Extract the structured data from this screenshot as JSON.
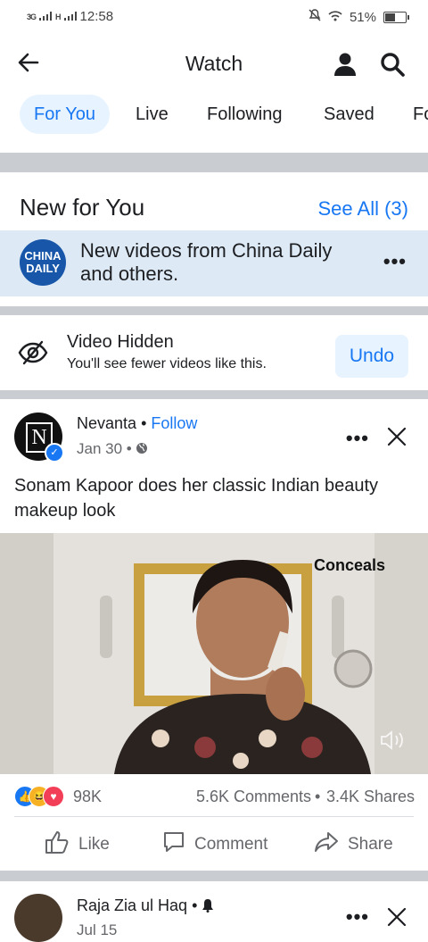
{
  "status_bar": {
    "network1": "3G",
    "network2": "H",
    "time": "12:58",
    "battery": "51%",
    "battery_fraction": 0.51
  },
  "header": {
    "title": "Watch"
  },
  "tabs": [
    {
      "label": "For You",
      "active": true
    },
    {
      "label": "Live"
    },
    {
      "label": "Following"
    },
    {
      "label": "Saved"
    },
    {
      "label": "Fo"
    }
  ],
  "new_for_you": {
    "title": "New for You",
    "see_all": "See All (3)",
    "item": {
      "logo_line1": "CHINA",
      "logo_line2": "DAILY",
      "text": "New videos from China Daily and others.",
      "more": "•••"
    }
  },
  "hidden_notice": {
    "title": "Video Hidden",
    "subtitle": "You'll see fewer videos like this.",
    "undo": "Undo"
  },
  "post": {
    "author": "Nevanta",
    "follow": "Follow",
    "date": "Jan 30",
    "caption": "Sonam Kapoor does her classic Indian beauty makeup look",
    "video_overlay": "Conceals",
    "reactions_count": "98K",
    "comments": "5.6K Comments",
    "shares": "3.4K Shares",
    "actions": {
      "like": "Like",
      "comment": "Comment",
      "share": "Share"
    }
  },
  "next_post": {
    "author": "Raja Zia ul Haq",
    "date": "Jul 15"
  },
  "colors": {
    "accent": "#1877f2",
    "tab_active_bg": "#e7f3ff",
    "separator": "#c9ccd1"
  }
}
